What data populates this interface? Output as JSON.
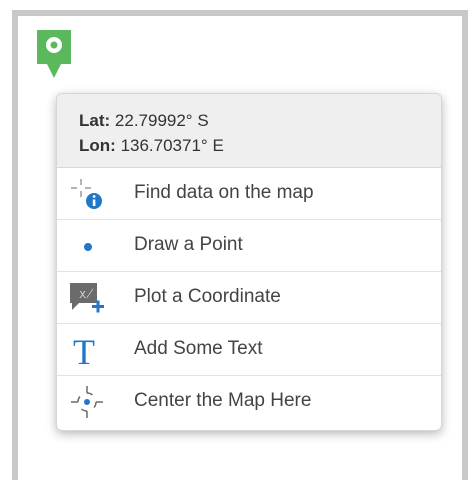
{
  "popup": {
    "coordinates": {
      "lat_label": "Lat:",
      "lat_value": "22.79992° S",
      "lon_label": "Lon:",
      "lon_value": "136.70371° E"
    },
    "items": [
      {
        "label": "Find data on the map",
        "icon": "find-data-icon"
      },
      {
        "label": "Draw a Point",
        "icon": "point-icon"
      },
      {
        "label": "Plot a Coordinate",
        "icon": "plot-coordinate-icon"
      },
      {
        "label": "Add Some Text",
        "icon": "text-icon"
      },
      {
        "label": "Center the Map Here",
        "icon": "crosshair-icon"
      }
    ]
  },
  "colors": {
    "marker": "#5cb85c",
    "accent_blue": "#1f78c8",
    "icon_gray": "#6b6b6b"
  }
}
